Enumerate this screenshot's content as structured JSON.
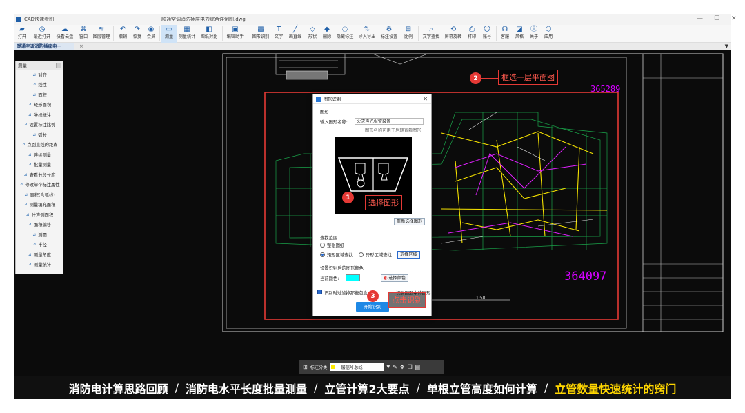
{
  "window": {
    "app_title": "CAD快速看图",
    "doc_title": "顺通空调消防插座电力综合详例图.dwg",
    "minimize": "—",
    "maximize": "☐",
    "close": "✕"
  },
  "toolbar": [
    {
      "label": "打开",
      "icon": "folder-icon"
    },
    {
      "label": "最近打开",
      "icon": "clock-icon"
    },
    {
      "label": "快看云盘",
      "icon": "cloud-icon"
    },
    {
      "label": "窗口",
      "icon": "window-icon"
    },
    {
      "label": "图层管理",
      "icon": "layers-icon"
    },
    {
      "label": "撤销",
      "icon": "undo-icon"
    },
    {
      "label": "恢复",
      "icon": "redo-icon"
    },
    {
      "label": "会员",
      "icon": "vip-icon"
    },
    {
      "label": "测量",
      "icon": "measure-icon",
      "active": true
    },
    {
      "label": "测量统计",
      "icon": "measure-stats-icon"
    },
    {
      "label": "图纸对比",
      "icon": "compare-icon"
    },
    {
      "label": "编辑助手",
      "icon": "edit-helper-icon"
    },
    {
      "label": "图形识别",
      "icon": "shape-recognize-icon"
    },
    {
      "label": "文字",
      "icon": "text-icon"
    },
    {
      "label": "画直线",
      "icon": "line-icon"
    },
    {
      "label": "形状",
      "icon": "shape-icon"
    },
    {
      "label": "删除",
      "icon": "eraser-icon"
    },
    {
      "label": "隐藏标注",
      "icon": "hide-icon"
    },
    {
      "label": "导入导出",
      "icon": "import-export-icon"
    },
    {
      "label": "标注设置",
      "icon": "annotation-settings-icon"
    },
    {
      "label": "比例",
      "icon": "scale-icon"
    },
    {
      "label": "文字查找",
      "icon": "text-search-icon"
    },
    {
      "label": "屏幕旋转",
      "icon": "rotate-icon"
    },
    {
      "label": "打印",
      "icon": "print-icon"
    },
    {
      "label": "账号",
      "icon": "user-icon"
    },
    {
      "label": "客服",
      "icon": "headset-icon"
    },
    {
      "label": "风格",
      "icon": "style-icon"
    },
    {
      "label": "关于",
      "icon": "info-icon"
    },
    {
      "label": "应用",
      "icon": "apps-icon"
    }
  ],
  "tab": {
    "label": "暖通空调消防插座电一",
    "close": "×",
    "dropdown": "▼"
  },
  "measure_panel": {
    "title": "测量",
    "items": [
      "对齐",
      "线性",
      "面积",
      "矩形面积",
      "坐标标注",
      "设置标注比例",
      "弧长",
      "点到直线的距离",
      "连续测量",
      "批量测量",
      "查看分段长度",
      "修改单个标注属性",
      "面积(含弧线)",
      "测量填充面积",
      "计算侧面积",
      "面积偏移",
      "测圆",
      "半径",
      "测量角度",
      "测量统计"
    ]
  },
  "dialog": {
    "title": "图形识别",
    "close": "✕",
    "section_shape": "图形",
    "name_label": "输入图形名称:",
    "name_value": "火灾声光报警装置",
    "name_hint": "图形名称可用于后期查看图形",
    "reselect_button": "重新选择图形",
    "search_range_label": "查找范围",
    "radio_all": "整张图纸",
    "radio_rect": "矩形区域查找",
    "radio_irregular": "异形区域查找",
    "select_area_button": "选择区域",
    "color_section": "设置识别后的图形颜色",
    "current_color_label": "当前颜色:",
    "current_color": "#00ffff",
    "select_color_button": "选择颜色",
    "filter_checkbox": "识别时过滤掉那些包含",
    "filter_suffix": "识别图形中的图形",
    "start_button": "开始识别"
  },
  "annotations": [
    {
      "num": "1",
      "text": "选择图形"
    },
    {
      "num": "2",
      "text": "框选一层平面图"
    },
    {
      "num": "3",
      "text": "点击识别"
    }
  ],
  "drawing": {
    "number_top": "365289",
    "number_bottom": "364097",
    "scale_text": "1:50"
  },
  "statusbar": {
    "label": "标注分类",
    "layer": "一层信号总线"
  },
  "banner": {
    "items": [
      "消防电计算思路回顾",
      "消防电水平长度批量测量",
      "立管计算2大要点",
      "单根立管高度如何计算",
      "立管数量快速统计的窍门"
    ],
    "separator": "/"
  },
  "colors": {
    "accent": "#1e88e5",
    "annotation_red": "#e53935",
    "highlight_yellow": "#ffd600",
    "magenta": "#d400ff"
  }
}
